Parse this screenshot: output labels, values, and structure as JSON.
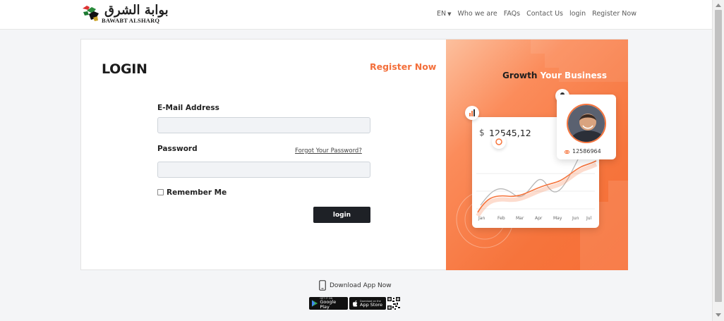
{
  "brand": {
    "arabic": "بوابة الشرق",
    "latin": "BAWABT ALSHARQ"
  },
  "nav": {
    "lang": "EN",
    "who": "Who we are",
    "faqs": "FAQs",
    "contact": "Contact Us",
    "login": "login",
    "register": "Register Now"
  },
  "form": {
    "title": "LOGIN",
    "register_link": "Register Now",
    "email_label": "E-Mail Address",
    "email_value": "",
    "password_label": "Password",
    "password_value": "",
    "forgot": "Forgot Your Password?",
    "remember": "Remember Me",
    "remember_checked": false,
    "submit": "login"
  },
  "promo": {
    "title_dark": "Growth",
    "title_light": "Your Business",
    "currency": "$",
    "amount": "12545,12",
    "profile_number": "12586964",
    "months": [
      "Jan",
      "Feb",
      "Mar",
      "Apr",
      "May",
      "Jun",
      "Jul"
    ],
    "accent": "#f6743c"
  },
  "footer": {
    "download": "Download App Now",
    "google_small": "GET IT ON",
    "google_big": "Google Play",
    "apple_small": "Download on the",
    "apple_big": "App Store"
  },
  "colors": {
    "brand_orange": "#f36f3b",
    "button_dark": "#1e2126"
  }
}
